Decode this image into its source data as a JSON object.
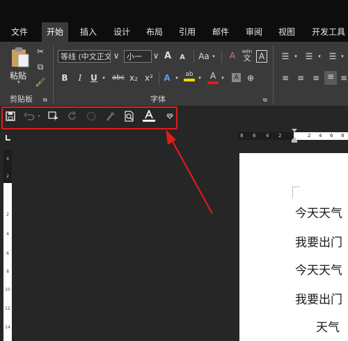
{
  "tabs": [
    "文件",
    "开始",
    "插入",
    "设计",
    "布局",
    "引用",
    "邮件",
    "审阅",
    "视图",
    "开发工具"
  ],
  "active_tab": "开始",
  "ribbon": {
    "clipboard": {
      "paste_label": "粘贴",
      "group_label": "剪贴板"
    },
    "font": {
      "font_name": "等线 (中文正文)",
      "font_size": "小一",
      "group_label": "字体",
      "bold": "B",
      "italic": "I",
      "underline": "U",
      "strike": "abc",
      "subscript": "x₂",
      "superscript": "x²",
      "grow": "A",
      "shrink": "A",
      "case": "Aa",
      "phonetic_top": "wén",
      "phonetic_bottom": "文",
      "border_char": "A"
    }
  },
  "qat": {
    "buttons": [
      "save",
      "undo",
      "touch-mode",
      "redo",
      "circle",
      "format-painter",
      "print-preview",
      "font-color",
      "customize"
    ]
  },
  "ruler": {
    "h_numbers": [
      "8",
      "6",
      "4",
      "2",
      "2",
      "4",
      "6",
      "8"
    ],
    "v_numbers": [
      "4",
      "2",
      "2",
      "4",
      "6",
      "8",
      "10",
      "12",
      "14"
    ]
  },
  "document": {
    "lines": [
      "今天天气",
      "我要出门",
      "今天天气",
      "我要出门",
      "天气"
    ]
  },
  "colors": {
    "highlight": "#ffd400",
    "font_color_bar": "#e81818",
    "annotation": "#e11b1b"
  }
}
